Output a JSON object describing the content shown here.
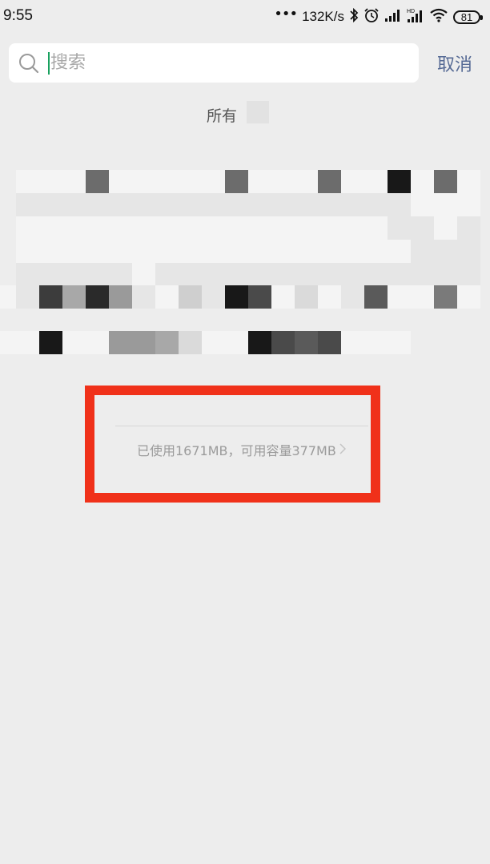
{
  "status_bar": {
    "time": "9:55",
    "dots": "•••",
    "network_speed": "132K/s",
    "icons": [
      "bluetooth-icon",
      "alarm-icon",
      "signal-icon",
      "hd-signal-icon",
      "wifi-icon",
      "battery-icon"
    ],
    "battery_level": "81"
  },
  "search": {
    "placeholder": "搜索",
    "value": "",
    "cursor_color": "#19a15f"
  },
  "cancel_label": "取消",
  "section_title": "所有",
  "storage": {
    "text": "已使用1671MB，可用容量377MB"
  },
  "colors": {
    "background": "#ededed",
    "link": "#576b95",
    "highlight": "#f0311a"
  }
}
